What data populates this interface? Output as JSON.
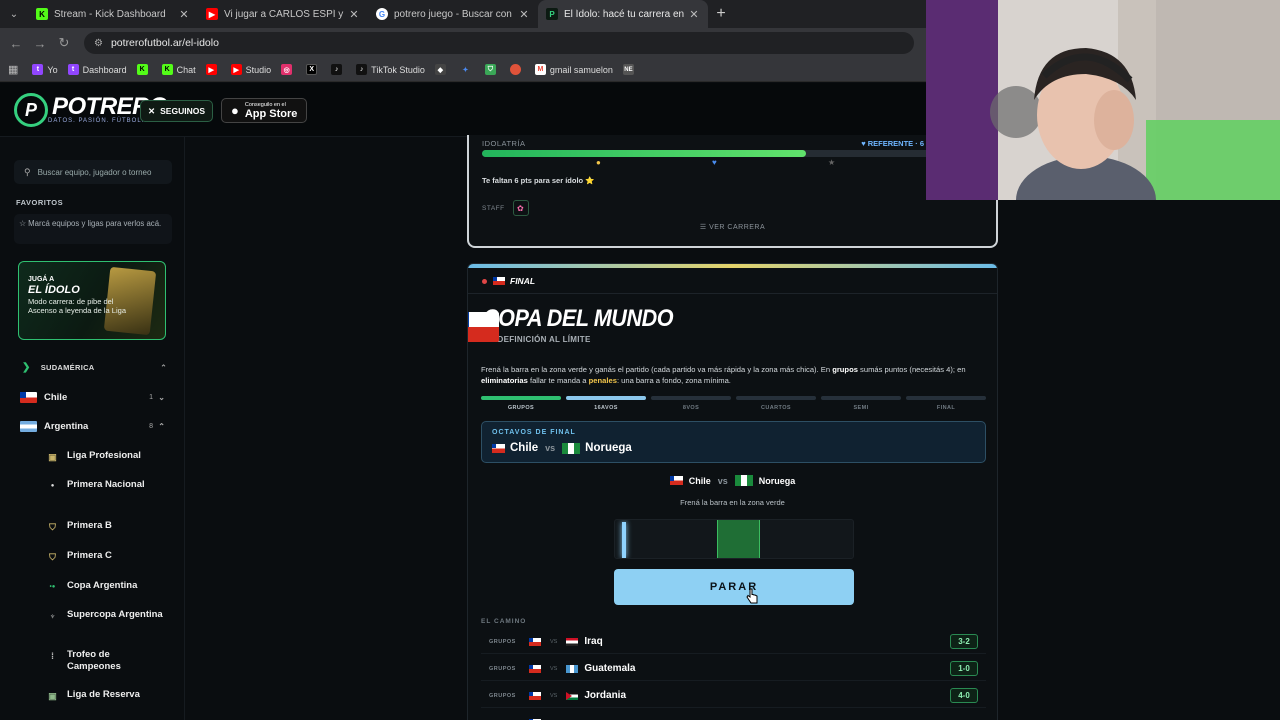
{
  "browser": {
    "tabs": [
      {
        "title": "Stream - Kick Dashboard",
        "icon": "kick-icon",
        "color": "#53fc18"
      },
      {
        "title": "Vi jugar a CARLOS ESPÍ y descu",
        "icon": "youtube-icon",
        "color": "#ff0000"
      },
      {
        "title": "potrero juego - Buscar con Go",
        "icon": "google-icon",
        "color": "#4285f4"
      },
      {
        "title": "El Ídolo: hacé tu carrera en la Li",
        "icon": "potrero-icon",
        "color": "#35d07f"
      }
    ],
    "url": "potrerofutbol.ar/el-idolo",
    "bookmarks": [
      {
        "label": "Yo",
        "icon": "twitch-icon",
        "color": "#9146ff"
      },
      {
        "label": "Dashboard",
        "icon": "twitch-icon",
        "color": "#9146ff"
      },
      {
        "label": "",
        "icon": "kick-icon",
        "color": "#53fc18"
      },
      {
        "label": "Chat",
        "icon": "kick-icon",
        "color": "#53fc18"
      },
      {
        "label": "",
        "icon": "youtube-icon",
        "color": "#ff0000"
      },
      {
        "label": "Studio",
        "icon": "youtube-icon",
        "color": "#ff0000"
      },
      {
        "label": "",
        "icon": "instagram-icon",
        "color": "#e1306c"
      },
      {
        "label": "",
        "icon": "x-icon",
        "color": "#000000"
      },
      {
        "label": "",
        "icon": "tiktok-icon",
        "color": "#111111"
      },
      {
        "label": "TikTok Studio",
        "icon": "tiktok-icon",
        "color": "#111111"
      },
      {
        "label": "",
        "icon": "diamond-icon",
        "color": "#cccccc"
      },
      {
        "label": "",
        "icon": "sparkle-icon",
        "color": "#4b8af0"
      },
      {
        "label": "",
        "icon": "shield-icon",
        "color": "#3aa757"
      },
      {
        "label": "",
        "icon": "circle-icon",
        "color": "#e0533a"
      },
      {
        "label": "gmail samuelon",
        "icon": "gmail-icon",
        "color": "#ea4335"
      },
      {
        "label": "",
        "icon": "ne-icon",
        "color": "#555555"
      }
    ]
  },
  "site": {
    "brand": "POTRERO",
    "tagline": "DATOS. PASIÓN. FÚTBOL.",
    "follow_label": "SEGUINOS",
    "appstore_small": "Conseguilo en el",
    "appstore_big": "App Store"
  },
  "sidebar": {
    "search_placeholder": "Buscar equipo, jugador o torneo",
    "favorites_title": "FAVORITOS",
    "favorites_hint": "Marcá equipos y ligas para verlos acá.",
    "promo": {
      "kicker": "JUGÁ A",
      "title": "EL ÍDOLO",
      "text": "Modo carrera: de pibe del Ascenso a leyenda de la Liga"
    },
    "region": "SUDAMÉRICA",
    "countries": [
      {
        "name": "Chile",
        "count": "1"
      },
      {
        "name": "Argentina",
        "count": "8"
      }
    ],
    "leagues": [
      "Liga Profesional",
      "Primera Nacional",
      "Primera B",
      "Primera C",
      "Copa Argentina",
      "Supercopa Argentina",
      "Trofeo de Campeones",
      "Liga de Reserva"
    ]
  },
  "career": {
    "idol_label": "IDOLATRÍA",
    "level_label": "REFERENTE · 6",
    "progress": 0.72,
    "need_text": "Te faltan 6 pts para ser ídolo ⭐",
    "staff_label": "STAFF",
    "view_career": "VER CARRERA"
  },
  "match": {
    "phase": "FINAL",
    "title": "COPA DEL MUNDO",
    "subtitle": "LA DEFINICIÓN AL LÍMITE",
    "desc_a": "Frená la barra en la zona verde y ganás el partido (cada partido va más rápida y la zona más chica). En ",
    "desc_b": "grupos",
    "desc_c": " sumás puntos (necesitás 4); en ",
    "desc_d": "eliminatorias",
    "desc_e": " fallar te manda a ",
    "desc_f": "penales",
    "desc_g": ": una barra a fondo, zona mínima.",
    "stages": [
      {
        "label": "GRUPOS",
        "state": "done"
      },
      {
        "label": "16AVOS",
        "state": "current"
      },
      {
        "label": "8VOS",
        "state": "pending"
      },
      {
        "label": "CUARTOS",
        "state": "pending"
      },
      {
        "label": "SEMI",
        "state": "pending"
      },
      {
        "label": "FINAL",
        "state": "pending"
      }
    ],
    "round_title": "OCTAVOS DE FINAL",
    "home": "Chile",
    "vs": "vs",
    "away": "Noruega",
    "hint": "Frená la barra en la zona verde",
    "green_zone": [
      0.43,
      0.61
    ],
    "cursor_pos": 0.03,
    "stop_label": "PARAR",
    "path_title": "EL CAMINO",
    "path": [
      {
        "stage": "GRUPOS",
        "vs": "VS",
        "opponent": "Iraq",
        "score": "3-2"
      },
      {
        "stage": "GRUPOS",
        "vs": "VS",
        "opponent": "Guatemala",
        "score": "1-0"
      },
      {
        "stage": "GRUPOS",
        "vs": "VS",
        "opponent": "Jordania",
        "score": "4-0"
      }
    ]
  }
}
